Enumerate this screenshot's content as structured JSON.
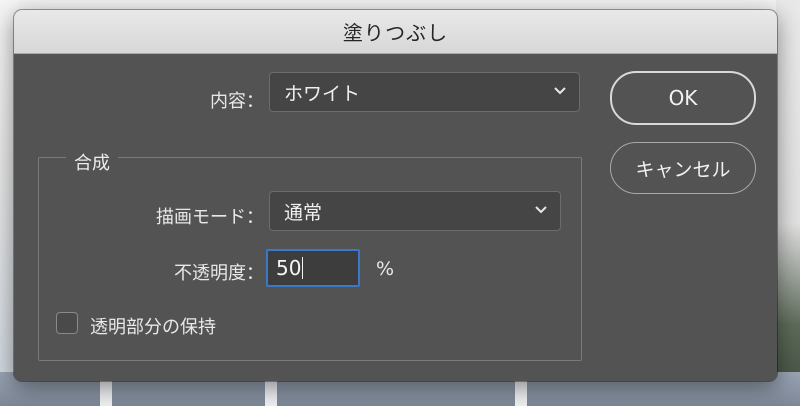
{
  "dialog": {
    "title": "塗りつぶし",
    "contents": {
      "label": "内容：",
      "value": "ホワイト"
    },
    "blending": {
      "group_title": "合成",
      "mode": {
        "label": "描画モード：",
        "value": "通常"
      },
      "opacity": {
        "label": "不透明度：",
        "value": "50",
        "unit": "%"
      },
      "preserve_transparency": {
        "label": "透明部分の保持",
        "checked": false
      }
    },
    "buttons": {
      "ok": "OK",
      "cancel": "キャンセル"
    }
  },
  "colors": {
    "dialog_bg": "#535353",
    "focus_ring": "#3a78c9",
    "titlebar": "#d7d7d7"
  },
  "icons": {
    "dropdown": "chevron-down-icon"
  }
}
